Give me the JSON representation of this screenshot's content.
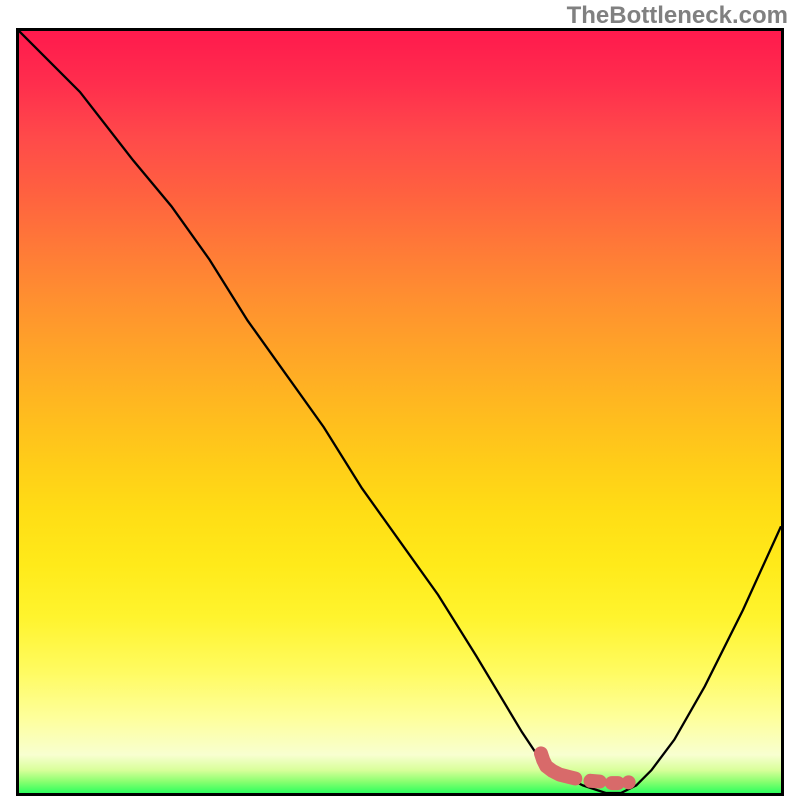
{
  "watermark": "TheBottleneck.com",
  "chart_data": {
    "type": "line",
    "title": "",
    "xlabel": "",
    "ylabel": "",
    "xlim": [
      0,
      100
    ],
    "ylim": [
      0,
      100
    ],
    "series": [
      {
        "name": "bottleneck-curve",
        "x": [
          0,
          8,
          15,
          20,
          25,
          30,
          35,
          40,
          45,
          50,
          55,
          60,
          63,
          66,
          68,
          70,
          72,
          74,
          77,
          79,
          81,
          83,
          86,
          90,
          95,
          100
        ],
        "values": [
          100,
          92,
          83,
          77,
          70,
          62,
          55,
          48,
          40,
          33,
          26,
          18,
          13,
          8,
          5,
          3,
          2,
          1,
          0,
          0,
          1,
          3,
          7,
          14,
          24,
          35
        ]
      }
    ],
    "optimal_segments": [
      {
        "name": "thick",
        "x": [
          68.5,
          68.8,
          69.2,
          70.0,
          71.0,
          72.2,
          73.0
        ],
        "values": [
          5.2,
          4.3,
          3.5,
          2.9,
          2.4,
          2.1,
          1.9
        ]
      },
      {
        "name": "dash1",
        "x": [
          75.0,
          76.2
        ],
        "values": [
          1.6,
          1.5
        ]
      },
      {
        "name": "dash2",
        "x": [
          77.8,
          78.6
        ],
        "values": [
          1.3,
          1.3
        ]
      },
      {
        "name": "dot",
        "x": [
          80.0,
          80.0
        ],
        "values": [
          1.4,
          1.4
        ]
      }
    ],
    "gradient_description": "vertical red-to-yellow-to-green heatmap background indicating bottleneck severity"
  },
  "colors": {
    "curve": "#000000",
    "highlight": "#d86a6a",
    "watermark": "#808080"
  }
}
